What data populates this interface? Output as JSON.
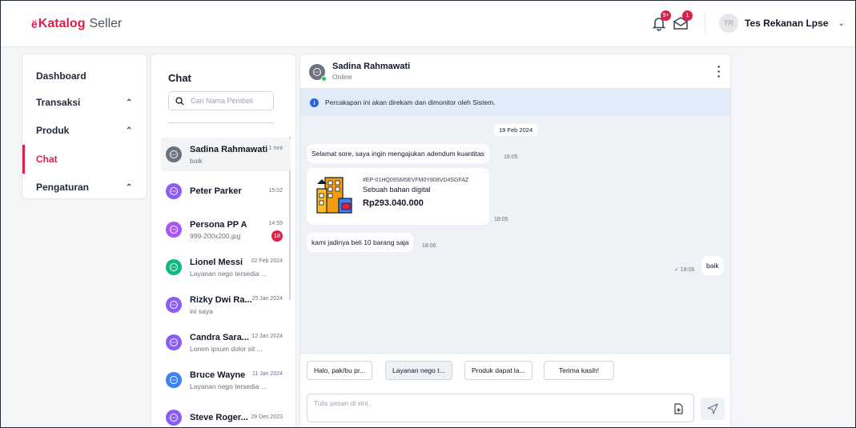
{
  "app": {
    "brand_icon": "ë",
    "brand_main": "Katalog",
    "brand_sub": "Seller"
  },
  "topbar": {
    "notif_badge": "9+",
    "mail_badge": "1",
    "user_initials": "TR",
    "user_name": "Tes Rekanan Lpse"
  },
  "menu": {
    "items": [
      {
        "label": "Dashboard",
        "has_caret": false
      },
      {
        "label": "Transaksi",
        "has_caret": true
      },
      {
        "label": "Produk",
        "has_caret": true
      },
      {
        "label": "Chat",
        "has_caret": false,
        "active": true
      },
      {
        "label": "Pengaturan",
        "has_caret": true
      }
    ]
  },
  "chat_list": {
    "title": "Chat",
    "search_placeholder": "Cari Nama Pembeli",
    "conversations": [
      {
        "name": "Sadina Rahmawati",
        "time": "1 mnt",
        "message": "baik",
        "avatar_color": "#6b7280",
        "selected": true
      },
      {
        "name": "Peter Parker",
        "time": "15:02",
        "message": "",
        "avatar_color": "#8b5cf6"
      },
      {
        "name": "Persona PP A",
        "time": "14:59",
        "message": "999-200x200.jpg",
        "avatar_color": "#a855f7",
        "unread": "18"
      },
      {
        "name": "Lionel Messi",
        "time": "02 Feb 2024",
        "message": "Layanan nego tersedia ...",
        "avatar_color": "#10b981"
      },
      {
        "name": "Rizky Dwi Ra...",
        "time": "25 Jan 2024",
        "message": "ini saya",
        "avatar_color": "#8b5cf6"
      },
      {
        "name": "Candra Sara...",
        "time": "12 Jan 2024",
        "message": "Lorem ipsum dolor sit ...",
        "avatar_color": "#8b5cf6"
      },
      {
        "name": "Bruce Wayne",
        "time": "11 Jan 2024",
        "message": "Layanan nego tersedia ...",
        "avatar_color": "#3b82f6"
      },
      {
        "name": "Steve Roger...",
        "time": "29 Des 2023",
        "message": "",
        "avatar_color": "#8b5cf6"
      }
    ]
  },
  "room": {
    "contact_name": "Sadina Rahmawati",
    "contact_status": "Online",
    "notice": "Percakapan ini akan direkam dan dimonitor oleh Sistem.",
    "date_chip": "19 Feb 2024",
    "messages": {
      "m1_text": "Selamat sore, saya ingin mengajukan adendum kuantitas",
      "m1_time": "18:05",
      "product_id": "#EP-01HQ09SM5EVFM0Y808VD4SGFAZ",
      "product_name": "Sebuah bahan digital",
      "product_price": "Rp293.040.000",
      "product_time": "18:05",
      "m3_text": "kami jadinya beli 10 barang saja",
      "m3_time": "18:06",
      "m4_text": "baik",
      "m4_time": "✓ 18:06"
    },
    "quick_replies": [
      "Halo, pak/bu pr...",
      "Layanan nego t...",
      "Produk dapat la...",
      "Terima kasih!"
    ],
    "input_placeholder": "Tulis pesan di sini.."
  }
}
